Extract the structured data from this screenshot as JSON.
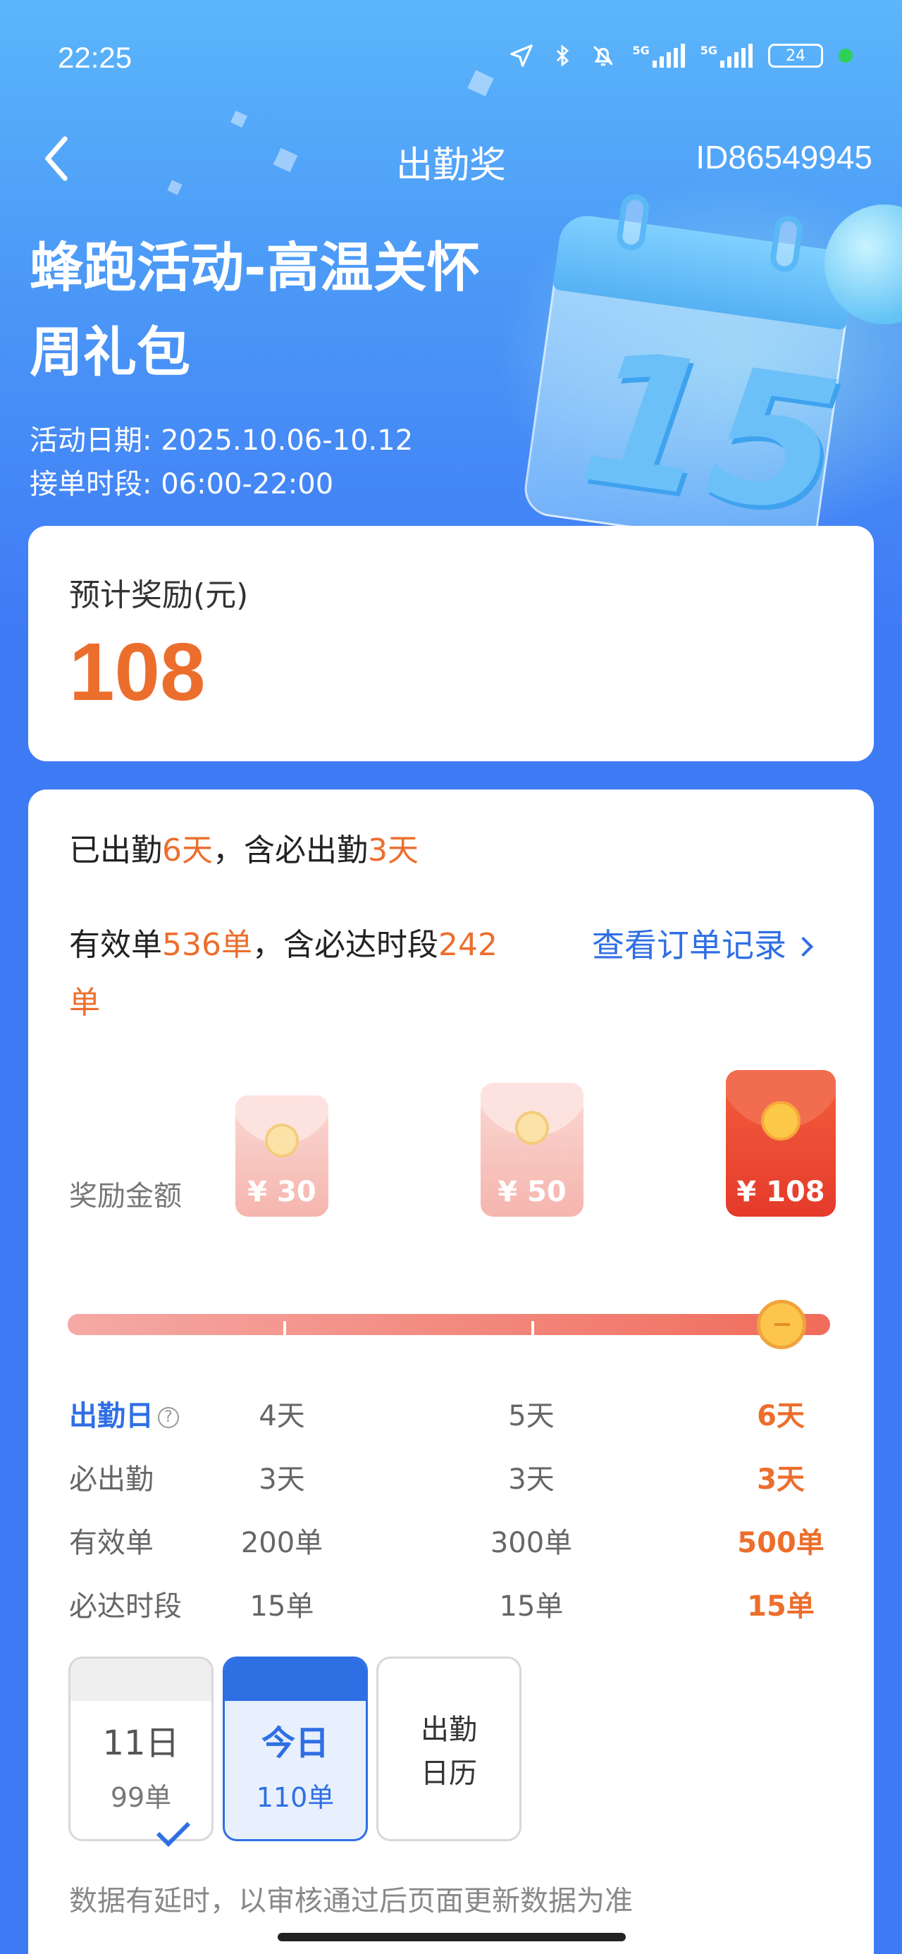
{
  "status_bar": {
    "time": "22:25",
    "network_label_1": "5G",
    "network_label_2": "5G",
    "battery": "24"
  },
  "nav": {
    "title": "出勤奖",
    "id_text": "ID86549945"
  },
  "activity": {
    "title_line1": "蜂跑活动-高温关怀",
    "title_line2": "周礼包",
    "date_text": "活动日期: 2025.10.06-10.12",
    "period_text": "接单时段: 06:00-22:00",
    "illustration_number": "15"
  },
  "estimate": {
    "label": "预计奖励(元)",
    "amount": "108"
  },
  "summary": {
    "attend_prefix": "已出勤",
    "attend_days": "6天",
    "attend_mid": "，含必出勤",
    "required_days": "3天",
    "orders_prefix": "有效单",
    "orders_count": "536单",
    "orders_mid": "，含必达时段",
    "required_orders_num": "242",
    "required_orders_unit": "单",
    "view_orders_link": "查看订单记录"
  },
  "rewards": {
    "label": "奖励金额",
    "tiers": [
      {
        "amount": "¥ 30"
      },
      {
        "amount": "¥ 50"
      },
      {
        "amount": "¥ 108"
      }
    ],
    "progress": 1.0
  },
  "table": {
    "rows": [
      {
        "header": "出勤日",
        "values": [
          "4天",
          "5天",
          "6天"
        ]
      },
      {
        "header": "必出勤",
        "values": [
          "3天",
          "3天",
          "3天"
        ]
      },
      {
        "header": "有效单",
        "values": [
          "200单",
          "300单",
          "500单"
        ]
      },
      {
        "header": "必达时段",
        "values": [
          "15单",
          "15单",
          "15单"
        ]
      }
    ],
    "help_glyph": "?"
  },
  "days": [
    {
      "date": "11日",
      "orders": "99单"
    },
    {
      "date": "今日",
      "orders": "110单"
    }
  ],
  "calendar_button": {
    "line1": "出勤",
    "line2": "日历"
  },
  "footer_note": "数据有延时，以审核通过后页面更新数据为准",
  "colors": {
    "accent_orange": "#ec6e2d",
    "link_blue": "#2f6fe4",
    "background_blue": "#3f7af5"
  }
}
